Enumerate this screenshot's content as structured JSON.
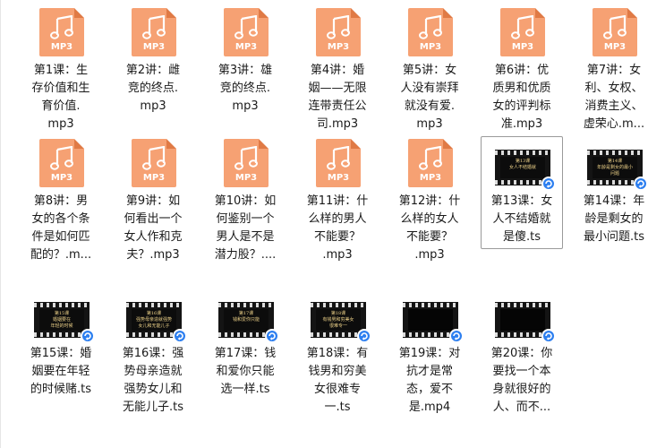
{
  "files": [
    {
      "name": "第1课：生存价值和生育价值.mp3",
      "lines": [
        "第1课：生",
        "存价值和生",
        "育价值.",
        "mp3"
      ],
      "type": "mp3",
      "badge": "MP3"
    },
    {
      "name": "第2讲：雌竞的终点.mp3",
      "lines": [
        "第2讲：雌",
        "竞的终点.",
        "mp3"
      ],
      "type": "mp3",
      "badge": "MP3"
    },
    {
      "name": "第3讲：雄竞的终点.mp3",
      "lines": [
        "第3讲：雄",
        "竞的终点.",
        "mp3"
      ],
      "type": "mp3",
      "badge": "MP3"
    },
    {
      "name": "第4讲：婚姻——无限连带责任公司.mp3",
      "lines": [
        "第4讲：婚",
        "姻——无限",
        "连带责任公",
        "司.mp3"
      ],
      "type": "mp3",
      "badge": "MP3"
    },
    {
      "name": "第5讲：女人没有崇拜就没有爱.mp3",
      "lines": [
        "第5讲：女",
        "人没有崇拜",
        "就没有爱.",
        "mp3"
      ],
      "type": "mp3",
      "badge": "MP3"
    },
    {
      "name": "第6讲：优质男和优质女的评判标准.mp3",
      "lines": [
        "第6讲：优",
        "质男和优质",
        "女的评判标",
        "准.mp3"
      ],
      "type": "mp3",
      "badge": "MP3"
    },
    {
      "name": "第7讲：女利、女权、消费主义、虚荣心.mp3",
      "lines": [
        "第7讲：女",
        "利、女权、",
        "消费主义、",
        "虚荣心.m..."
      ],
      "type": "mp3",
      "badge": "MP3"
    },
    {
      "name": "第8讲：男女的各个条件是如何匹配的？.mp3",
      "lines": [
        "第8讲：男",
        "女的各个条",
        "件是如何匹",
        "配的？.m..."
      ],
      "type": "mp3",
      "badge": "MP3"
    },
    {
      "name": "第9讲：如何看出一个女人作和克夫？.mp3",
      "lines": [
        "第9讲：如",
        "何看出一个",
        "女人作和克",
        "夫？.mp3"
      ],
      "type": "mp3",
      "badge": "MP3"
    },
    {
      "name": "第10讲：如何鉴别一个男人是不是潜力股？.mp3",
      "lines": [
        "第10讲：如",
        "何鉴别一个",
        "男人是不是",
        "潜力股？...."
      ],
      "type": "mp3",
      "badge": "MP3"
    },
    {
      "name": "第11讲：什么样的男人不能要？.mp3",
      "lines": [
        "第11讲：什",
        "么样的男人",
        "不能要？",
        ".mp3"
      ],
      "type": "mp3",
      "badge": "MP3"
    },
    {
      "name": "第12讲：什么样的女人不能要？.mp3",
      "lines": [
        "第12讲：什",
        "么样的女人",
        "不能要？",
        ".mp3"
      ],
      "type": "mp3",
      "badge": "MP3"
    },
    {
      "name": "第13课：女人不结婚就是傻.ts",
      "lines": [
        "第13课：女",
        "人不结婚就",
        "是傻.ts"
      ],
      "type": "video",
      "frame_text": "第13课\n女人不结婚就",
      "selected": true
    },
    {
      "name": "第14课：年龄是剩女的最小问题.ts",
      "lines": [
        "第14课：年",
        "龄是剩女的",
        "最小问题.ts"
      ],
      "type": "video",
      "frame_text": "第14课\n年龄是剩女的最小\n问题"
    },
    {
      "name": "第15课：婚姻要在年轻的时候赌.ts",
      "lines": [
        "第15课：婚",
        "姻要在年轻",
        "的时候赌.ts"
      ],
      "type": "video",
      "frame_text": "第15课\n婚姻要在\n年轻的时候"
    },
    {
      "name": "第16课：强势母亲造就强势女儿和无能儿子.ts",
      "lines": [
        "第16课：强",
        "势母亲造就",
        "强势女儿和",
        "无能儿子.ts"
      ],
      "type": "video",
      "frame_text": "第16课\n强势母亲造就强势\n女儿和无能儿子"
    },
    {
      "name": "第17课：钱和爱你只能选一样.ts",
      "lines": [
        "第17课：钱",
        "和爱你只能",
        "选一样.ts"
      ],
      "type": "video",
      "frame_text": "第17课\n钱和爱你只能"
    },
    {
      "name": "第18课：有钱男和穷美女很难专一.ts",
      "lines": [
        "第18课：有",
        "钱男和穷美",
        "女很难专",
        "一.ts"
      ],
      "type": "video",
      "frame_text": "第18课\n有钱男和穷美女\n很难专一"
    },
    {
      "name": "第19课：对抗才是常态，爱不是.mp4",
      "lines": [
        "第19课：对",
        "抗才是常",
        "态，爱不",
        "是.mp4"
      ],
      "type": "video",
      "frame_text": "",
      "dark": true
    },
    {
      "name": "第20课：你要找一个本身就很好的人、而不...",
      "lines": [
        "第20课：你",
        "要找一个本",
        "身就很好的",
        "人、而不..."
      ],
      "type": "video",
      "frame_text": "",
      "dark": true
    }
  ]
}
